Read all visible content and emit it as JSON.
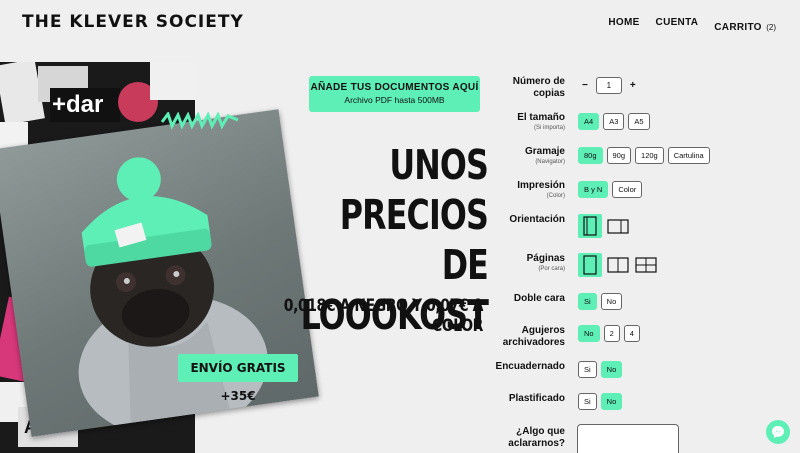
{
  "header": {
    "logo": "THE KLEVER SOCIETY",
    "nav": [
      {
        "label": "HOME"
      },
      {
        "label": "CUENTA"
      },
      {
        "label": "CARRITO",
        "count": "(2)"
      }
    ]
  },
  "collage": {
    "sticker_texts": [
      "+dar",
      "AM"
    ]
  },
  "upload": {
    "title": "AÑADE TUS DOCUMENTOS AQUÍ",
    "subtitle": "Archivo PDF hasta 500MB"
  },
  "hero": {
    "line1": "UNOS PRECIOS",
    "line2": "DE LOOOKOST",
    "prices": "0,018€ A NEGRO Y 0,07€ A COLOR",
    "shipping": "ENVÍO GRATIS +35€"
  },
  "form": {
    "copies": {
      "label": "Número de copias",
      "minus": "−",
      "value": "1",
      "plus": "+"
    },
    "size": {
      "label": "El tamaño",
      "sub": "(Si importa)",
      "options": [
        "A4",
        "A3",
        "A5"
      ],
      "selected": "A4"
    },
    "weight": {
      "label": "Gramaje",
      "sub": "(Navigator)",
      "options": [
        "80g",
        "90g",
        "120g",
        "Cartulina"
      ],
      "selected": "80g"
    },
    "print": {
      "label": "Impresión",
      "sub": "(Color)",
      "options": [
        "B y N",
        "Color"
      ],
      "selected": "B y N"
    },
    "orientation": {
      "label": "Orientación",
      "options": [
        "portrait-icon",
        "landscape-icon"
      ],
      "selected": "portrait-icon"
    },
    "pages": {
      "label": "Páginas",
      "sub": "(Por cara)",
      "options": [
        "one-page-icon",
        "two-pages-icon",
        "four-pages-icon"
      ],
      "selected": "one-page-icon"
    },
    "duplex": {
      "label": "Doble cara",
      "options": [
        "Si",
        "No"
      ],
      "selected": "Si"
    },
    "holes": {
      "label": "Agujeros archivadores",
      "options": [
        "No",
        "2",
        "4"
      ],
      "selected": "No"
    },
    "binding": {
      "label": "Encuadernado",
      "options": [
        "Si",
        "No"
      ],
      "selected": "No"
    },
    "laminated": {
      "label": "Plastificado",
      "options": [
        "Si",
        "No"
      ],
      "selected": "No"
    },
    "notes": {
      "label": "¿Algo que aclararnos?"
    }
  },
  "colors": {
    "accent": "#5eefb6",
    "background": "#efefef",
    "text": "#111111"
  },
  "chat": {
    "icon": "messenger-icon"
  }
}
